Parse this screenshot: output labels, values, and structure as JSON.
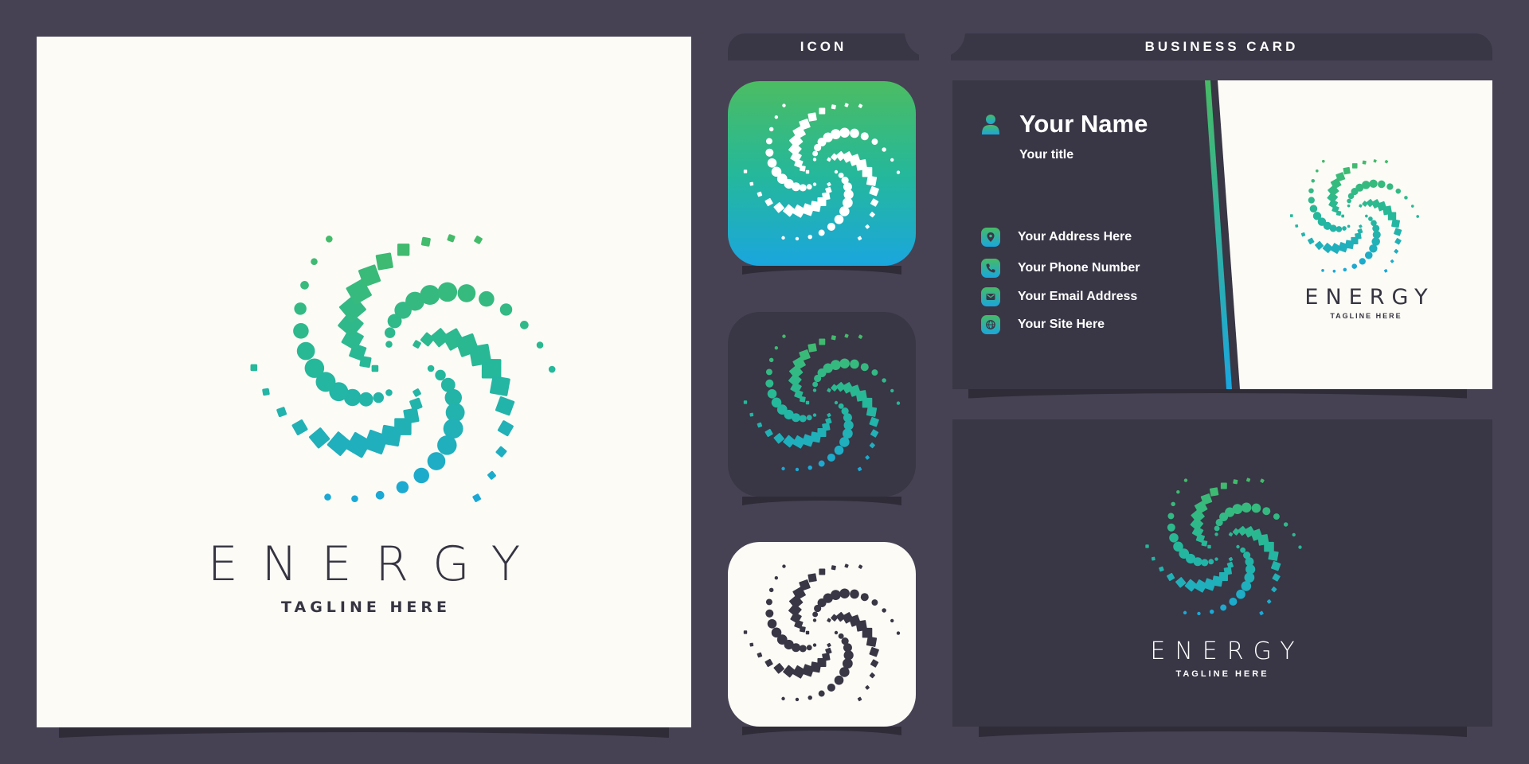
{
  "brand": {
    "name": "ENERGY",
    "tagline": "TAGLINE HERE"
  },
  "tabs": [
    {
      "label": "ICON"
    },
    {
      "label": "BUSINESS CARD"
    }
  ],
  "icon_tiles": [
    {
      "variant": "gradient",
      "logo_color": "white"
    },
    {
      "variant": "dark",
      "logo_color": "gradient"
    },
    {
      "variant": "light",
      "logo_color": "dark"
    }
  ],
  "business_card": {
    "name": "Your Name",
    "title": "Your title",
    "contacts": [
      {
        "icon": "location-pin-icon",
        "text": "Your Address Here"
      },
      {
        "icon": "phone-icon",
        "text": "Your Phone Number"
      },
      {
        "icon": "email-icon",
        "text": "Your Email Address"
      },
      {
        "icon": "globe-icon",
        "text": "Your Site Here"
      }
    ]
  },
  "colors": {
    "background": "#464254",
    "panel_dark": "#393645",
    "panel_light": "#fcfbf6",
    "text_dark": "#363441",
    "accent_green": "#47bb64",
    "accent_teal": "#25b89a",
    "accent_blue": "#1aa6de"
  }
}
